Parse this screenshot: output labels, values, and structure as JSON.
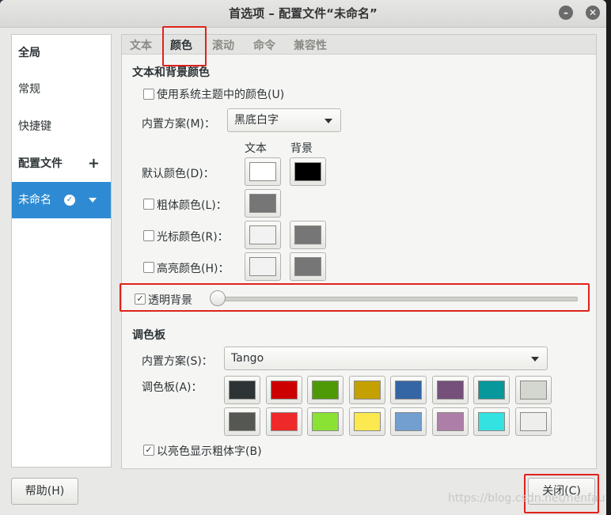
{
  "window": {
    "title": "首选项 – 配置文件“未命名”",
    "minimize_icon": "minimize-icon",
    "close_icon": "close-icon"
  },
  "sidebar": {
    "items": [
      {
        "label": "全局",
        "bold": true
      },
      {
        "label": "常规",
        "bold": false
      },
      {
        "label": "快捷键",
        "bold": false
      },
      {
        "label": "配置文件",
        "bold": true,
        "action": "+"
      },
      {
        "label": "未命名",
        "selected": true,
        "icon": "check-circle-icon",
        "caret": "chevron-down-icon"
      }
    ]
  },
  "tabs": [
    {
      "label": "文本",
      "active": false
    },
    {
      "label": "颜色",
      "active": true
    },
    {
      "label": "滚动",
      "active": false
    },
    {
      "label": "命令",
      "active": false
    },
    {
      "label": "兼容性",
      "active": false
    }
  ],
  "text_bg": {
    "heading": "文本和背景颜色",
    "use_system_theme": {
      "label": "使用系统主题中的颜色(U)",
      "checked": false
    },
    "builtin_scheme_label": "内置方案(M)：",
    "builtin_scheme_value": "黑底白字",
    "col_text": "文本",
    "col_bg": "背景",
    "default_color": {
      "label": "默认颜色(D)：",
      "text": "#ffffff",
      "bg": "#000000"
    },
    "bold_color": {
      "label": "粗体颜色(L)：",
      "checked": false,
      "text": "#767676"
    },
    "cursor_color": {
      "label": "光标颜色(R)：",
      "checked": false,
      "text": "#f2f2f2",
      "bg": "#767676"
    },
    "highlight_color": {
      "label": "高亮颜色(H)：",
      "checked": false,
      "text": "#f2f2f2",
      "bg": "#767676"
    },
    "transparent_bg": {
      "label": "透明背景",
      "checked": true,
      "value": 0
    }
  },
  "palette": {
    "heading": "调色板",
    "builtin_scheme_label": "内置方案(S)：",
    "builtin_scheme_value": "Tango",
    "palette_label": "调色板(A)：",
    "row1": [
      "#2e3436",
      "#cc0000",
      "#4e9a06",
      "#c4a000",
      "#3465a4",
      "#75507b",
      "#06989a",
      "#d3d7cf"
    ],
    "row2": [
      "#555753",
      "#ef2929",
      "#8ae234",
      "#fce94f",
      "#729fcf",
      "#ad7fa8",
      "#34e2e2",
      "#eeeeec"
    ],
    "bright_bold": {
      "label": "以亮色显示粗体字(B)",
      "checked": true
    }
  },
  "footer": {
    "help_label": "帮助(H)",
    "close_label": "关闭(C)"
  },
  "watermark": "https://blog.csdn.net/nenfau",
  "accent_color": "#2e8bd3",
  "highlight_box_color": "#e0231b"
}
